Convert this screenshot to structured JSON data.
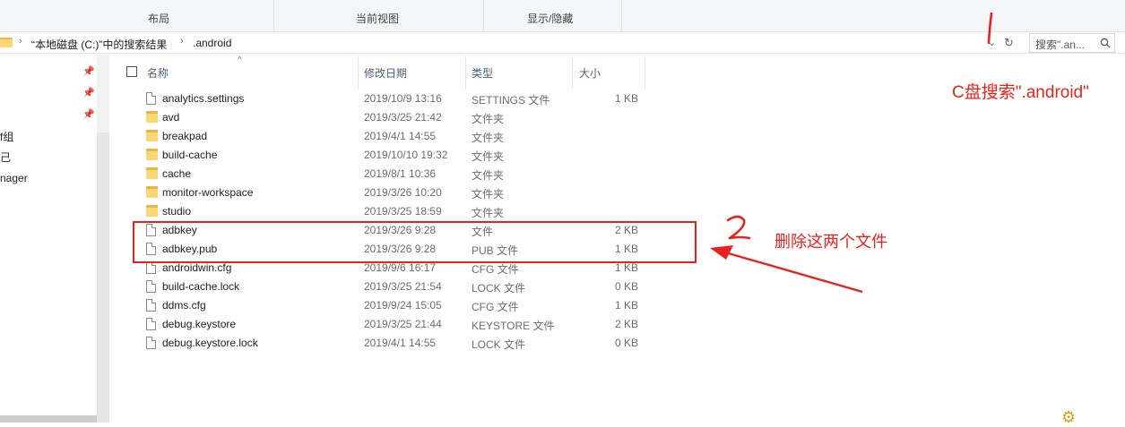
{
  "ribbon": {
    "groups": [
      "布局",
      "当前视图",
      "显示/隐藏"
    ]
  },
  "address": {
    "crumbs": [
      "“本地磁盘 (C:)”中的搜索结果",
      ".android"
    ],
    "search_placeholder": "搜索\".an..."
  },
  "nav": {
    "items": [
      "f组",
      "己",
      "nager"
    ]
  },
  "columns": {
    "name": "名称",
    "date": "修改日期",
    "type": "类型",
    "size": "大小"
  },
  "files": [
    {
      "name": "analytics.settings",
      "date": "2019/10/9 13:16",
      "type": "SETTINGS 文件",
      "size": "1 KB",
      "kind": "file"
    },
    {
      "name": "avd",
      "date": "2019/3/25 21:42",
      "type": "文件夹",
      "size": "",
      "kind": "folder"
    },
    {
      "name": "breakpad",
      "date": "2019/4/1 14:55",
      "type": "文件夹",
      "size": "",
      "kind": "folder"
    },
    {
      "name": "build-cache",
      "date": "2019/10/10 19:32",
      "type": "文件夹",
      "size": "",
      "kind": "folder"
    },
    {
      "name": "cache",
      "date": "2019/8/1 10:36",
      "type": "文件夹",
      "size": "",
      "kind": "folder"
    },
    {
      "name": "monitor-workspace",
      "date": "2019/3/26 10:20",
      "type": "文件夹",
      "size": "",
      "kind": "folder"
    },
    {
      "name": "studio",
      "date": "2019/3/25 18:59",
      "type": "文件夹",
      "size": "",
      "kind": "folder"
    },
    {
      "name": "adbkey",
      "date": "2019/3/26 9:28",
      "type": "文件",
      "size": "2 KB",
      "kind": "file"
    },
    {
      "name": "adbkey.pub",
      "date": "2019/3/26 9:28",
      "type": "PUB 文件",
      "size": "1 KB",
      "kind": "file"
    },
    {
      "name": "androidwin.cfg",
      "date": "2019/9/6 16:17",
      "type": "CFG 文件",
      "size": "1 KB",
      "kind": "file"
    },
    {
      "name": "build-cache.lock",
      "date": "2019/3/25 21:54",
      "type": "LOCK 文件",
      "size": "0 KB",
      "kind": "file"
    },
    {
      "name": "ddms.cfg",
      "date": "2019/9/24 15:05",
      "type": "CFG 文件",
      "size": "1 KB",
      "kind": "file"
    },
    {
      "name": "debug.keystore",
      "date": "2019/3/25 21:44",
      "type": "KEYSTORE 文件",
      "size": "2 KB",
      "kind": "file"
    },
    {
      "name": "debug.keystore.lock",
      "date": "2019/4/1 14:55",
      "type": "LOCK 文件",
      "size": "0 KB",
      "kind": "file"
    }
  ],
  "annotations": {
    "step1_number": "1",
    "step1_text": "C盘搜索\".android\"",
    "step2_number": "2",
    "step2_text": "删除这两个文件",
    "color": "#e8231f"
  }
}
